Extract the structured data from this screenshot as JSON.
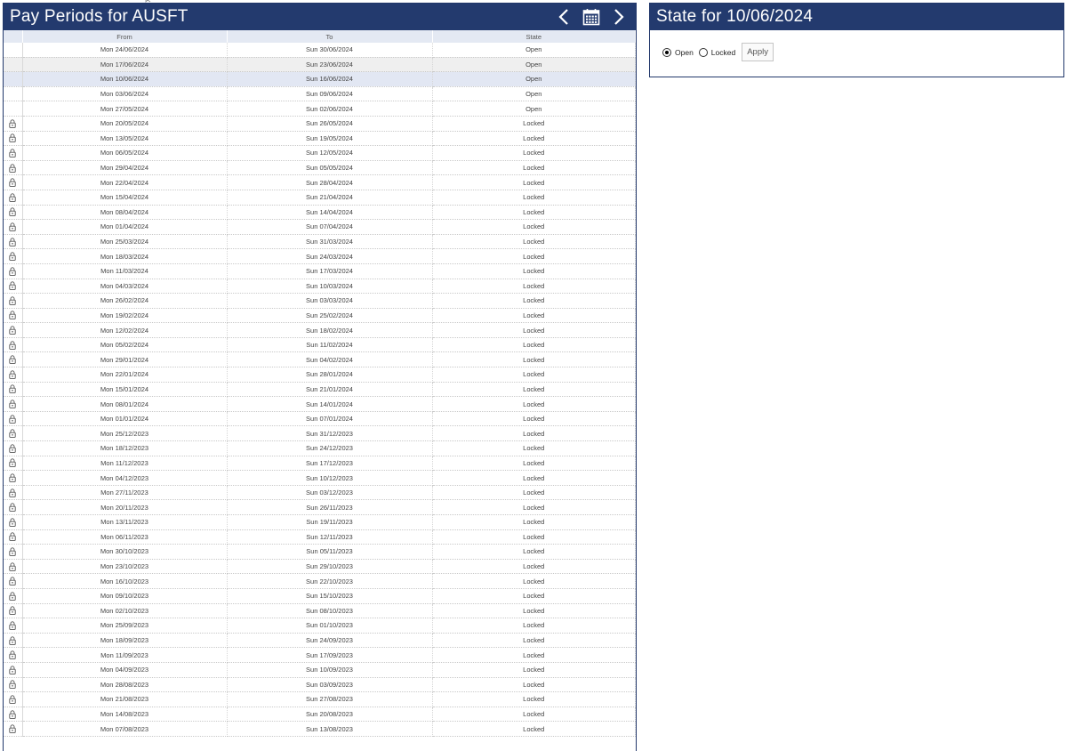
{
  "pay_periods": {
    "title": "Pay Periods for AUSFT",
    "columns": [
      "From",
      "To",
      "State"
    ],
    "rows": [
      {
        "from": "Mon 24/06/2024",
        "to": "Sun 30/06/2024",
        "state": "Open",
        "locked": false
      },
      {
        "from": "Mon 17/06/2024",
        "to": "Sun 23/06/2024",
        "state": "Open",
        "locked": false
      },
      {
        "from": "Mon 10/06/2024",
        "to": "Sun 16/06/2024",
        "state": "Open",
        "locked": false,
        "selected": true
      },
      {
        "from": "Mon 03/06/2024",
        "to": "Sun 09/06/2024",
        "state": "Open",
        "locked": false
      },
      {
        "from": "Mon 27/05/2024",
        "to": "Sun 02/06/2024",
        "state": "Open",
        "locked": false
      },
      {
        "from": "Mon 20/05/2024",
        "to": "Sun 26/05/2024",
        "state": "Locked",
        "locked": true
      },
      {
        "from": "Mon 13/05/2024",
        "to": "Sun 19/05/2024",
        "state": "Locked",
        "locked": true
      },
      {
        "from": "Mon 06/05/2024",
        "to": "Sun 12/05/2024",
        "state": "Locked",
        "locked": true
      },
      {
        "from": "Mon 29/04/2024",
        "to": "Sun 05/05/2024",
        "state": "Locked",
        "locked": true
      },
      {
        "from": "Mon 22/04/2024",
        "to": "Sun 28/04/2024",
        "state": "Locked",
        "locked": true
      },
      {
        "from": "Mon 15/04/2024",
        "to": "Sun 21/04/2024",
        "state": "Locked",
        "locked": true
      },
      {
        "from": "Mon 08/04/2024",
        "to": "Sun 14/04/2024",
        "state": "Locked",
        "locked": true
      },
      {
        "from": "Mon 01/04/2024",
        "to": "Sun 07/04/2024",
        "state": "Locked",
        "locked": true
      },
      {
        "from": "Mon 25/03/2024",
        "to": "Sun 31/03/2024",
        "state": "Locked",
        "locked": true
      },
      {
        "from": "Mon 18/03/2024",
        "to": "Sun 24/03/2024",
        "state": "Locked",
        "locked": true
      },
      {
        "from": "Mon 11/03/2024",
        "to": "Sun 17/03/2024",
        "state": "Locked",
        "locked": true
      },
      {
        "from": "Mon 04/03/2024",
        "to": "Sun 10/03/2024",
        "state": "Locked",
        "locked": true
      },
      {
        "from": "Mon 26/02/2024",
        "to": "Sun 03/03/2024",
        "state": "Locked",
        "locked": true
      },
      {
        "from": "Mon 19/02/2024",
        "to": "Sun 25/02/2024",
        "state": "Locked",
        "locked": true
      },
      {
        "from": "Mon 12/02/2024",
        "to": "Sun 18/02/2024",
        "state": "Locked",
        "locked": true
      },
      {
        "from": "Mon 05/02/2024",
        "to": "Sun 11/02/2024",
        "state": "Locked",
        "locked": true
      },
      {
        "from": "Mon 29/01/2024",
        "to": "Sun 04/02/2024",
        "state": "Locked",
        "locked": true
      },
      {
        "from": "Mon 22/01/2024",
        "to": "Sun 28/01/2024",
        "state": "Locked",
        "locked": true
      },
      {
        "from": "Mon 15/01/2024",
        "to": "Sun 21/01/2024",
        "state": "Locked",
        "locked": true
      },
      {
        "from": "Mon 08/01/2024",
        "to": "Sun 14/01/2024",
        "state": "Locked",
        "locked": true
      },
      {
        "from": "Mon 01/01/2024",
        "to": "Sun 07/01/2024",
        "state": "Locked",
        "locked": true
      },
      {
        "from": "Mon 25/12/2023",
        "to": "Sun 31/12/2023",
        "state": "Locked",
        "locked": true
      },
      {
        "from": "Mon 18/12/2023",
        "to": "Sun 24/12/2023",
        "state": "Locked",
        "locked": true
      },
      {
        "from": "Mon 11/12/2023",
        "to": "Sun 17/12/2023",
        "state": "Locked",
        "locked": true
      },
      {
        "from": "Mon 04/12/2023",
        "to": "Sun 10/12/2023",
        "state": "Locked",
        "locked": true
      },
      {
        "from": "Mon 27/11/2023",
        "to": "Sun 03/12/2023",
        "state": "Locked",
        "locked": true
      },
      {
        "from": "Mon 20/11/2023",
        "to": "Sun 26/11/2023",
        "state": "Locked",
        "locked": true
      },
      {
        "from": "Mon 13/11/2023",
        "to": "Sun 19/11/2023",
        "state": "Locked",
        "locked": true
      },
      {
        "from": "Mon 06/11/2023",
        "to": "Sun 12/11/2023",
        "state": "Locked",
        "locked": true
      },
      {
        "from": "Mon 30/10/2023",
        "to": "Sun 05/11/2023",
        "state": "Locked",
        "locked": true
      },
      {
        "from": "Mon 23/10/2023",
        "to": "Sun 29/10/2023",
        "state": "Locked",
        "locked": true
      },
      {
        "from": "Mon 16/10/2023",
        "to": "Sun 22/10/2023",
        "state": "Locked",
        "locked": true
      },
      {
        "from": "Mon 09/10/2023",
        "to": "Sun 15/10/2023",
        "state": "Locked",
        "locked": true
      },
      {
        "from": "Mon 02/10/2023",
        "to": "Sun 08/10/2023",
        "state": "Locked",
        "locked": true
      },
      {
        "from": "Mon 25/09/2023",
        "to": "Sun 01/10/2023",
        "state": "Locked",
        "locked": true
      },
      {
        "from": "Mon 18/09/2023",
        "to": "Sun 24/09/2023",
        "state": "Locked",
        "locked": true
      },
      {
        "from": "Mon 11/09/2023",
        "to": "Sun 17/09/2023",
        "state": "Locked",
        "locked": true
      },
      {
        "from": "Mon 04/09/2023",
        "to": "Sun 10/09/2023",
        "state": "Locked",
        "locked": true
      },
      {
        "from": "Mon 28/08/2023",
        "to": "Sun 03/09/2023",
        "state": "Locked",
        "locked": true
      },
      {
        "from": "Mon 21/08/2023",
        "to": "Sun 27/08/2023",
        "state": "Locked",
        "locked": true
      },
      {
        "from": "Mon 14/08/2023",
        "to": "Sun 20/08/2023",
        "state": "Locked",
        "locked": true
      },
      {
        "from": "Mon 07/08/2023",
        "to": "Sun 13/08/2023",
        "state": "Locked",
        "locked": true
      }
    ],
    "hover_row_index": 1,
    "nav": {
      "prev_icon": "chevron-left-icon",
      "calendar_icon": "calendar-icon",
      "next_icon": "chevron-right-icon"
    }
  },
  "state_panel": {
    "title": "State for 10/06/2024",
    "options": [
      {
        "label": "Open",
        "checked": true
      },
      {
        "label": "Locked",
        "checked": false
      }
    ],
    "apply_label": "Apply"
  },
  "colors": {
    "header_bg": "#233a6e",
    "header_text": "#ffffff",
    "column_header_bg": "#e4e9f3",
    "selected_row_bg": "#e2e7f3"
  }
}
